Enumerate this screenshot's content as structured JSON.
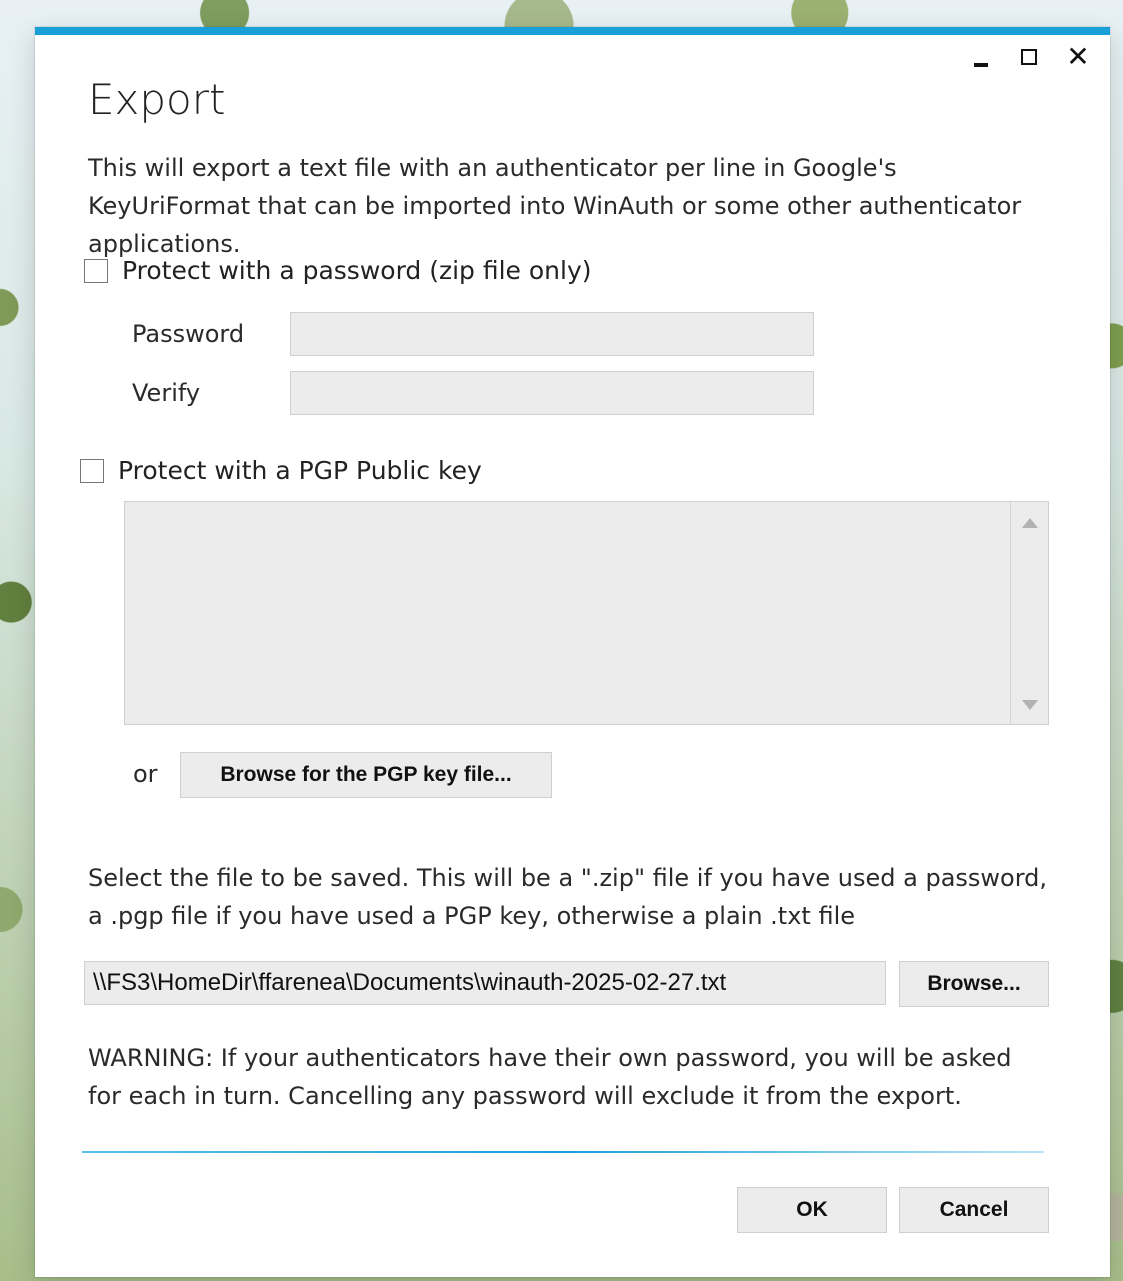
{
  "window": {
    "title": "Export",
    "description": "This will export a text file with an authenticator per line in Google's KeyUriFormat that can be imported into WinAuth or some other authenticator applications.",
    "controls": {
      "minimize": "minimize",
      "maximize": "maximize",
      "close": "✕"
    }
  },
  "passwordProtection": {
    "checkbox_label": "Protect with a password (zip file only)",
    "checked": false,
    "password_label": "Password",
    "password_value": "",
    "verify_label": "Verify",
    "verify_value": ""
  },
  "pgpProtection": {
    "checkbox_label": "Protect with a PGP Public key",
    "checked": false,
    "key_text": "",
    "or_label": "or",
    "browse_key_button": "Browse for the PGP key file..."
  },
  "fileSelection": {
    "instruction": "Select the file to be saved. This will be a \".zip\" file if you have used a password, a .pgp file if you have used a PGP key, otherwise a plain .txt file",
    "file_path": "\\\\FS3\\HomeDir\\ffarenea\\Documents\\winauth-2025-02-27.txt",
    "browse_button": "Browse..."
  },
  "warning": {
    "text": "WARNING: If your authenticators have their own password, you will be asked for each in turn. Cancelling any password will exclude it from the export."
  },
  "actions": {
    "ok_button": "OK",
    "cancel_button": "Cancel"
  },
  "colors": {
    "accent": "#1aa0d8",
    "field_background": "#ececec",
    "button_background": "#ececec"
  }
}
